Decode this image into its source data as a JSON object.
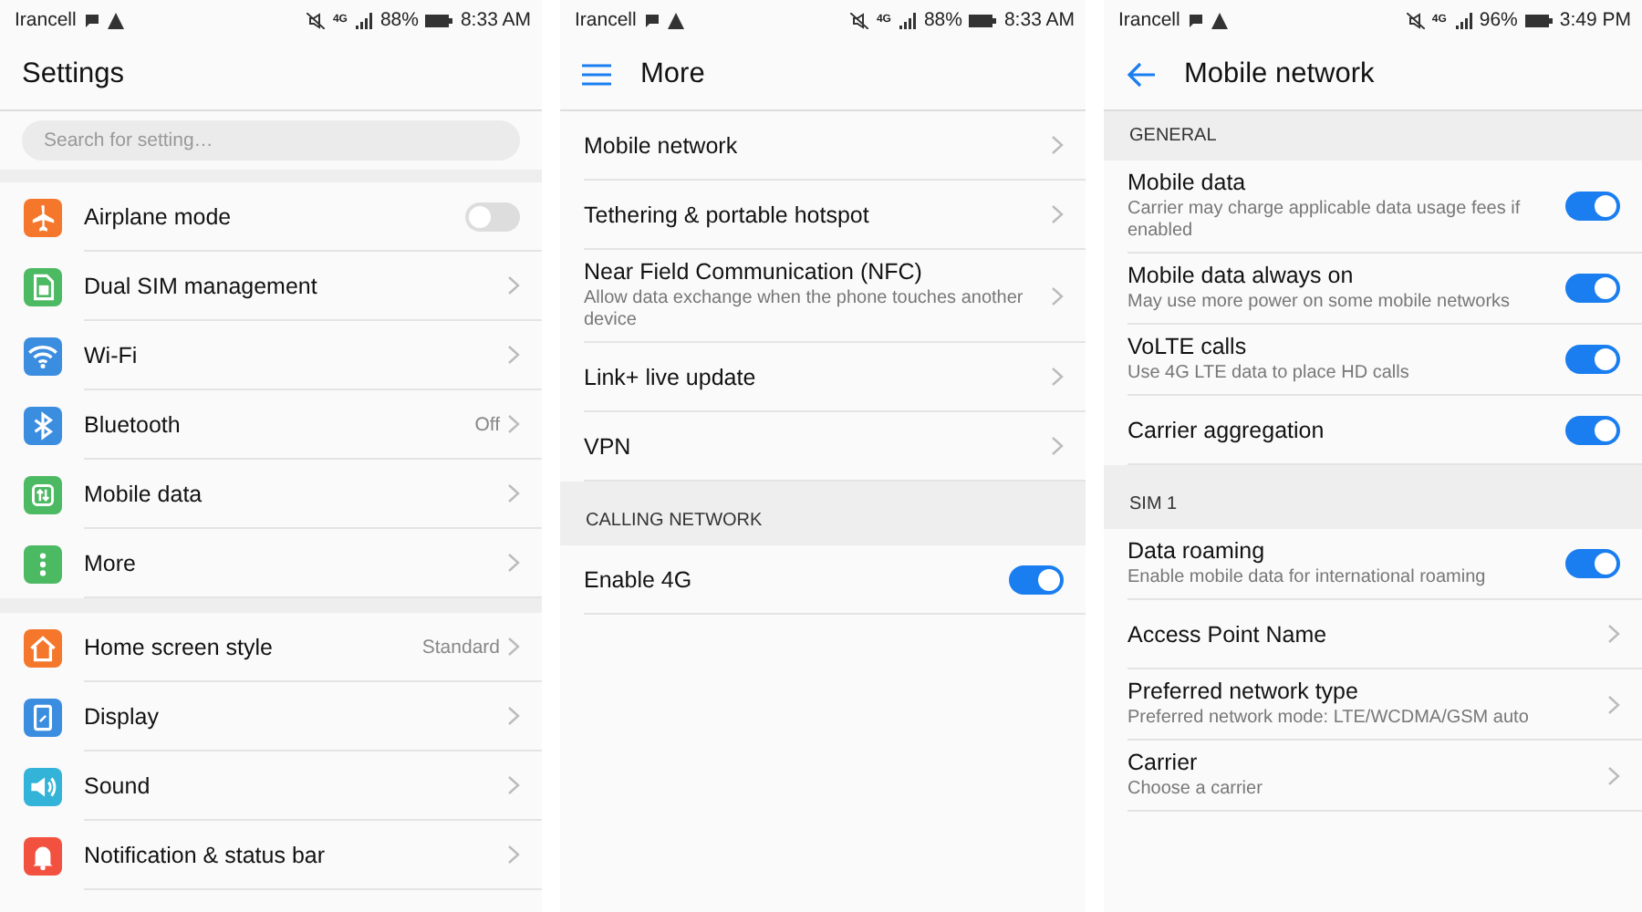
{
  "screens": [
    {
      "status": {
        "carrier": "Irancell",
        "network": "4G",
        "battery": "88%",
        "time": "8:33 AM"
      },
      "header": {
        "title": "Settings"
      },
      "search": {
        "placeholder": "Search for setting…"
      },
      "sections": [
        {
          "items": [
            {
              "kind": "toggle",
              "label": "Airplane mode",
              "on": false,
              "color": "#f4772b"
            },
            {
              "kind": "link",
              "label": "Dual SIM management",
              "color": "#4cb963"
            },
            {
              "kind": "link",
              "label": "Wi-Fi",
              "color": "#3b8de0"
            },
            {
              "kind": "link",
              "label": "Bluetooth",
              "value": "Off",
              "color": "#3b8de0"
            },
            {
              "kind": "link",
              "label": "Mobile data",
              "color": "#4cb963"
            },
            {
              "kind": "link",
              "label": "More",
              "color": "#4cb963"
            }
          ]
        },
        {
          "items": [
            {
              "kind": "link",
              "label": "Home screen style",
              "value": "Standard",
              "color": "#f4772b"
            },
            {
              "kind": "link",
              "label": "Display",
              "color": "#3b8de0"
            },
            {
              "kind": "link",
              "label": "Sound",
              "color": "#34b3d9"
            },
            {
              "kind": "link",
              "label": "Notification & status bar",
              "color": "#f2513f"
            }
          ]
        }
      ]
    },
    {
      "status": {
        "carrier": "Irancell",
        "network": "4G",
        "battery": "88%",
        "time": "8:33 AM"
      },
      "header": {
        "kind": "menu",
        "title": "More"
      },
      "sections": [
        {
          "items": [
            {
              "kind": "link",
              "label": "Mobile network"
            },
            {
              "kind": "link",
              "label": "Tethering & portable hotspot"
            },
            {
              "kind": "link",
              "label": "Near Field Communication (NFC)",
              "sub": "Allow data exchange when the phone touches another device"
            },
            {
              "kind": "link",
              "label": "Link+ live update"
            },
            {
              "kind": "link",
              "label": "VPN"
            }
          ]
        },
        {
          "title": "CALLING NETWORK",
          "items": [
            {
              "kind": "toggle",
              "label": "Enable 4G",
              "on": true
            }
          ]
        }
      ]
    },
    {
      "status": {
        "carrier": "Irancell",
        "network": "4G",
        "battery": "96%",
        "time": "3:49 PM"
      },
      "header": {
        "kind": "back",
        "title": "Mobile network"
      },
      "sections": [
        {
          "title": "GENERAL",
          "items": [
            {
              "kind": "toggle",
              "label": "Mobile data",
              "sub": "Carrier may charge applicable data usage fees if enabled",
              "on": true
            },
            {
              "kind": "toggle",
              "label": "Mobile data always on",
              "sub": "May use more power on some mobile networks",
              "on": true
            },
            {
              "kind": "toggle",
              "label": "VoLTE calls",
              "sub": "Use 4G LTE data to place HD calls",
              "on": true
            },
            {
              "kind": "toggle",
              "label": "Carrier aggregation",
              "on": true
            }
          ]
        },
        {
          "title": "SIM 1",
          "items": [
            {
              "kind": "toggle",
              "label": "Data roaming",
              "sub": "Enable mobile data for international roaming",
              "on": true
            },
            {
              "kind": "link",
              "label": "Access Point Name"
            },
            {
              "kind": "link",
              "label": "Preferred network type",
              "sub": "Preferred network mode: LTE/WCDMA/GSM auto"
            },
            {
              "kind": "link",
              "label": "Carrier",
              "sub": "Choose a carrier"
            }
          ]
        }
      ]
    }
  ]
}
